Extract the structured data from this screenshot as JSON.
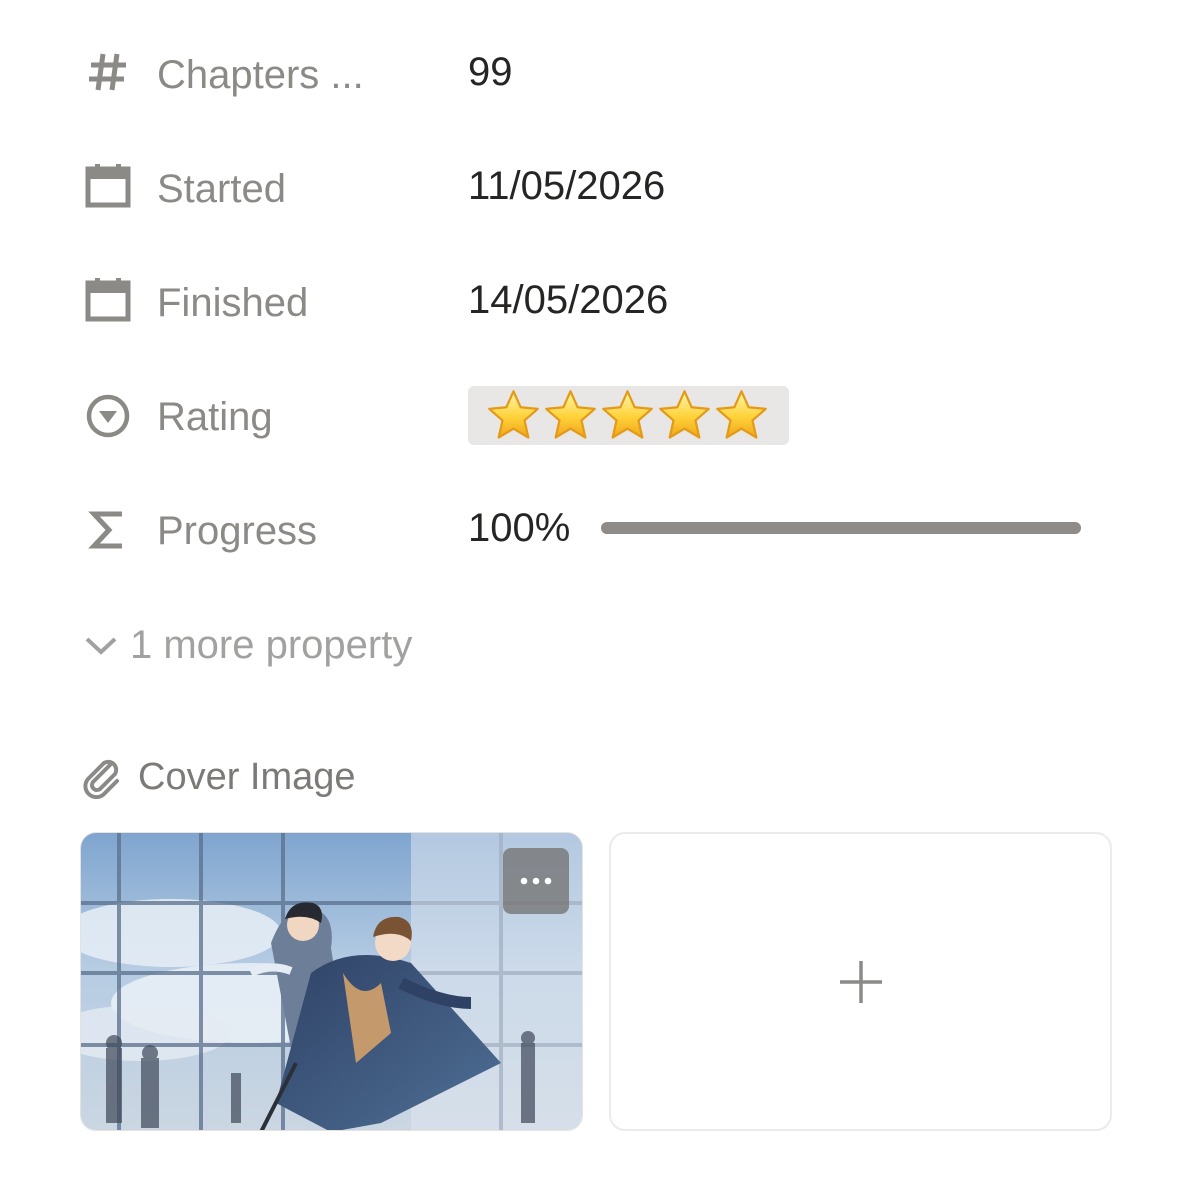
{
  "properties": {
    "chapters": {
      "icon": "hash-icon",
      "label": "Chapters ...",
      "value": "99"
    },
    "started": {
      "icon": "calendar-icon",
      "label": "Started",
      "value": "11/05/2026"
    },
    "finished": {
      "icon": "calendar-icon",
      "label": "Finished",
      "value": "14/05/2026"
    },
    "rating": {
      "icon": "select-circle-icon",
      "label": "Rating",
      "stars": 5,
      "star_icon": "star-icon"
    },
    "progress": {
      "icon": "sigma-icon",
      "label": "Progress",
      "value_text": "100%",
      "fraction": 1.0
    }
  },
  "more_properties": {
    "icon": "chevron-down-icon",
    "label": "1 more property"
  },
  "cover_section": {
    "icon": "paperclip-icon",
    "label": "Cover Image",
    "cover": {
      "menu_icon": "more-options-icon"
    },
    "add_icon": "plus-icon"
  },
  "colors": {
    "label_gray": "#8c8a87",
    "value_text": "#262524",
    "pill_bg": "#e8e7e5",
    "progress_bar": "#8f8b89"
  }
}
